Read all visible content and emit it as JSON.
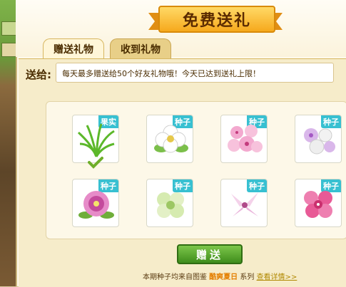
{
  "title": "免费送礼",
  "tabs": [
    {
      "label": "赠送礼物",
      "active": true
    },
    {
      "label": "收到礼物",
      "active": false
    }
  ],
  "send_to": {
    "label": "送给:",
    "value": "每天最多赠送给50个好友礼物哦！今天已达到送礼上限！"
  },
  "gifts": [
    {
      "badge": "果实",
      "icon": "grass-icon",
      "selected": true
    },
    {
      "badge": "种子",
      "icon": "white-flower-icon",
      "selected": false
    },
    {
      "badge": "种子",
      "icon": "pink-flower-icon",
      "selected": false
    },
    {
      "badge": "种子",
      "icon": "purple-white-flower-icon",
      "selected": false
    },
    {
      "badge": "种子",
      "icon": "magenta-flower-icon",
      "selected": false
    },
    {
      "badge": "种子",
      "icon": "green-flower-icon",
      "selected": false
    },
    {
      "badge": "种子",
      "icon": "lily-icon",
      "selected": false
    },
    {
      "badge": "种子",
      "icon": "red-pink-flower-icon",
      "selected": false
    }
  ],
  "send_button": "赠送",
  "footer": {
    "prefix": "本期种子均来自图鉴",
    "series_name": "酷爽夏日",
    "suffix": "系列",
    "link": "查看详情>>"
  },
  "colors": {
    "badge": "#37c0d1",
    "send_button": "#4f9f26",
    "ribbon": "#f6a91d"
  }
}
